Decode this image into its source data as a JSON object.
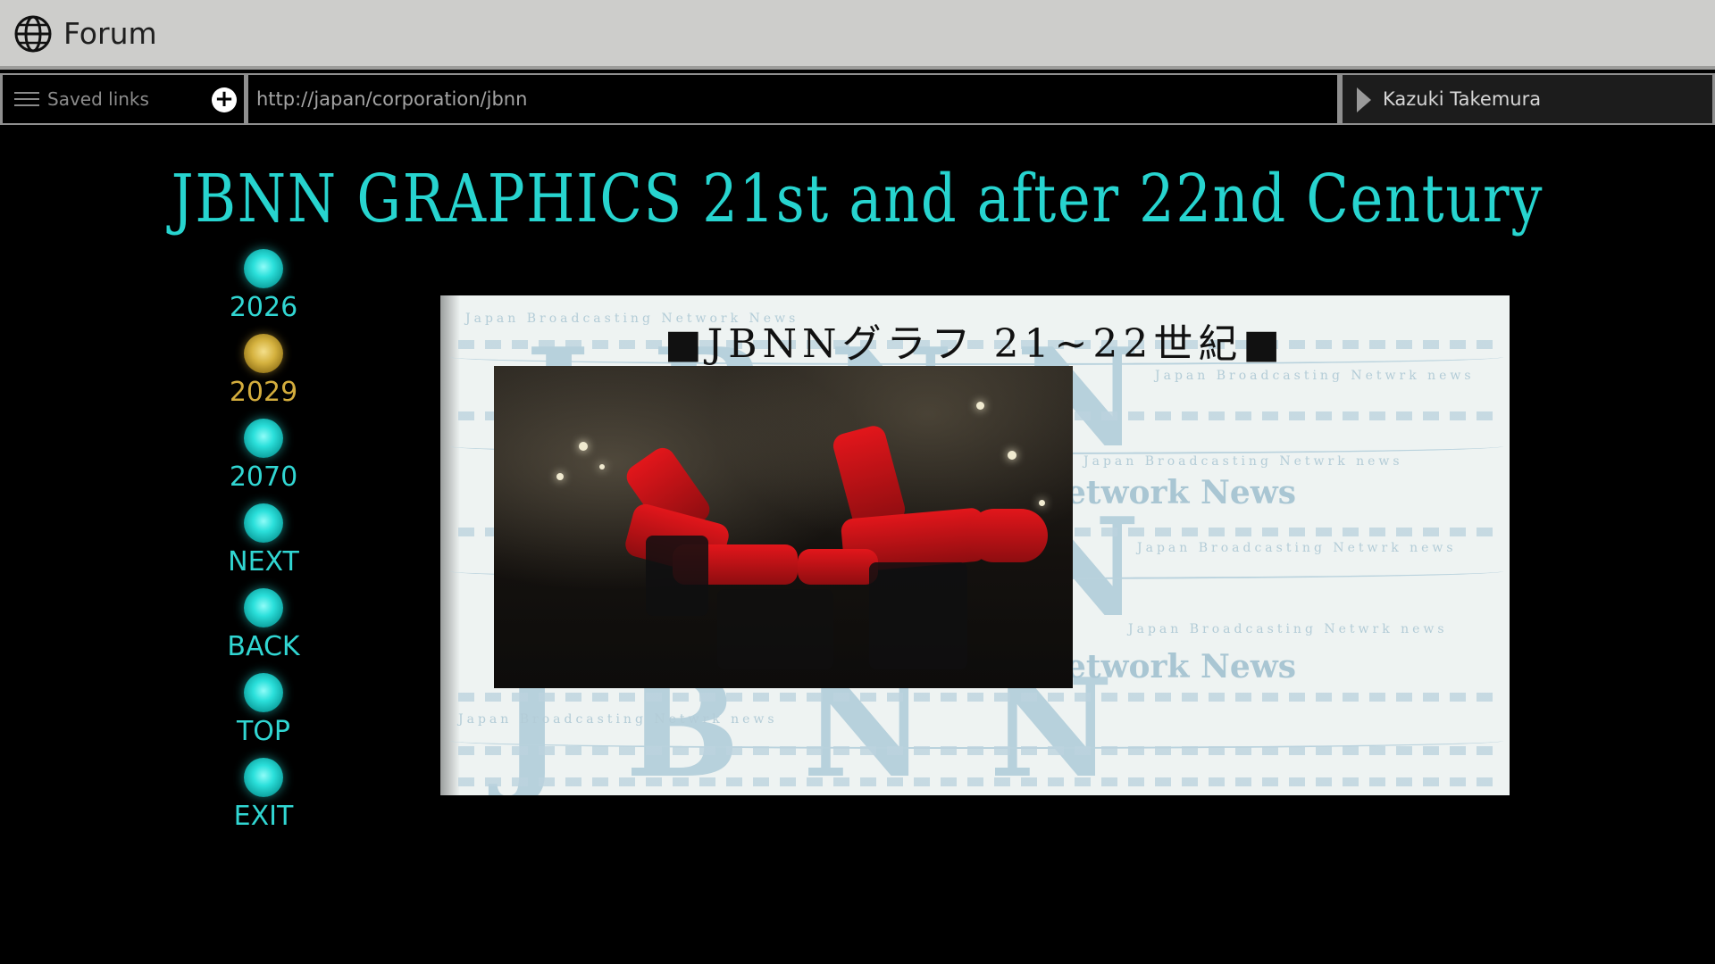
{
  "window": {
    "title": "Forum",
    "icon": "globe-icon"
  },
  "toolbar": {
    "saved_links_label": "Saved links",
    "add_icon": "plus-icon",
    "menu_icon": "hamburger-icon",
    "url": "http://japan/corporation/jbnn",
    "user_icon": "play-icon",
    "user_name": "Kazuki Takemura"
  },
  "page": {
    "title": "JBNN GRAPHICS 21st and after 22nd Century",
    "title_color": "#27d4cf"
  },
  "nav": {
    "items": [
      {
        "label": "2026",
        "state": "normal"
      },
      {
        "label": "2029",
        "state": "active"
      },
      {
        "label": "2070",
        "state": "normal"
      },
      {
        "label": "NEXT",
        "state": "normal"
      },
      {
        "label": "BACK",
        "state": "normal"
      },
      {
        "label": "TOP",
        "state": "normal"
      },
      {
        "label": "EXIT",
        "state": "normal"
      }
    ],
    "colors": {
      "normal": "#31d6d2",
      "active": "#d4ad3d"
    }
  },
  "panel": {
    "heading": "■JBNNグラフ 21~22世紀■",
    "watermark": "JBNN",
    "background_lines": [
      "Japan Broadcasting Network News",
      "Japan Broadcasting Netwrk news",
      "etwork News"
    ],
    "photo_alt": "red-robot-arms-photo"
  }
}
